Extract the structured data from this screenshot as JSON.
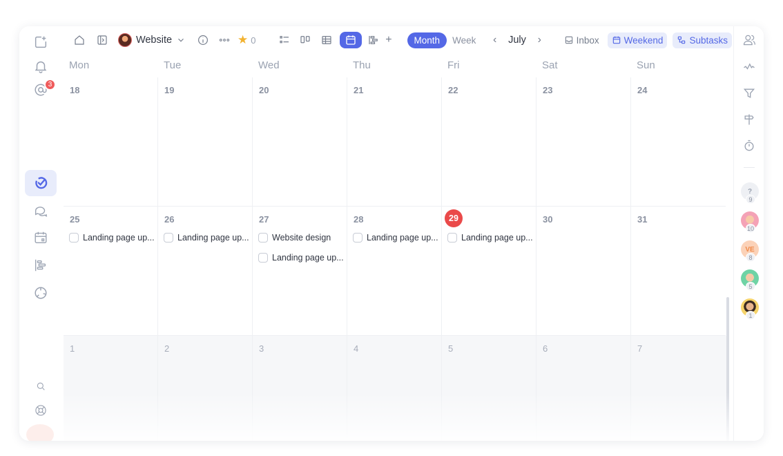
{
  "left_rail": {
    "mentions_badge": "3",
    "icons": [
      "new-task-icon",
      "bell-icon",
      "at-icon",
      "logo-icon",
      "chat-icon",
      "calendar-icon",
      "timeline-icon",
      "reports-icon",
      "search-icon",
      "help-icon"
    ]
  },
  "toolbar": {
    "project_name": "Website",
    "favorites_count": "0",
    "add_view_label": "+",
    "month_label": "Month",
    "week_label": "Week",
    "current_month": "July",
    "inbox_label": "Inbox",
    "weekend_label": "Weekend",
    "subtasks_label": "Subtasks"
  },
  "calendar": {
    "weekdays": [
      "Mon",
      "Tue",
      "Wed",
      "Thu",
      "Fri",
      "Sat",
      "Sun"
    ],
    "weeks": [
      {
        "days": [
          {
            "num": "18",
            "tasks": []
          },
          {
            "num": "19",
            "tasks": []
          },
          {
            "num": "20",
            "tasks": []
          },
          {
            "num": "21",
            "tasks": []
          },
          {
            "num": "22",
            "tasks": []
          },
          {
            "num": "23",
            "tasks": []
          },
          {
            "num": "24",
            "tasks": []
          }
        ]
      },
      {
        "days": [
          {
            "num": "25",
            "tasks": [
              "Landing page up..."
            ]
          },
          {
            "num": "26",
            "tasks": [
              "Landing page up..."
            ]
          },
          {
            "num": "27",
            "tasks": [
              "Website design",
              "Landing page up..."
            ]
          },
          {
            "num": "28",
            "tasks": [
              "Landing page up..."
            ]
          },
          {
            "num": "29",
            "today": true,
            "tasks": [
              "Landing page up..."
            ]
          },
          {
            "num": "30",
            "tasks": []
          },
          {
            "num": "31",
            "tasks": []
          }
        ]
      },
      {
        "days": [
          {
            "num": "1",
            "tasks": []
          },
          {
            "num": "2",
            "tasks": []
          },
          {
            "num": "3",
            "tasks": []
          },
          {
            "num": "4",
            "tasks": []
          },
          {
            "num": "5",
            "tasks": []
          },
          {
            "num": "6",
            "tasks": []
          },
          {
            "num": "7",
            "tasks": []
          }
        ]
      }
    ]
  },
  "right_rail": {
    "members": [
      {
        "initials": "?",
        "count": "9",
        "bg": "#eef0f4",
        "fg": "#9aa2b1"
      },
      {
        "initials": "",
        "count": "10",
        "bg": "#f4a2b6",
        "fg": "#ffffff"
      },
      {
        "initials": "VE",
        "count": "8",
        "bg": "#fbd2b8",
        "fg": "#f08a4b"
      },
      {
        "initials": "",
        "count": "5",
        "bg": "#6fd3a5",
        "fg": "#ffffff"
      },
      {
        "initials": "",
        "count": "1",
        "bg": "#f5d36b",
        "fg": "#ffffff"
      }
    ]
  },
  "colors": {
    "accent": "#5468e6",
    "today": "#ea4a4a",
    "badge": "#ef5b5b"
  }
}
